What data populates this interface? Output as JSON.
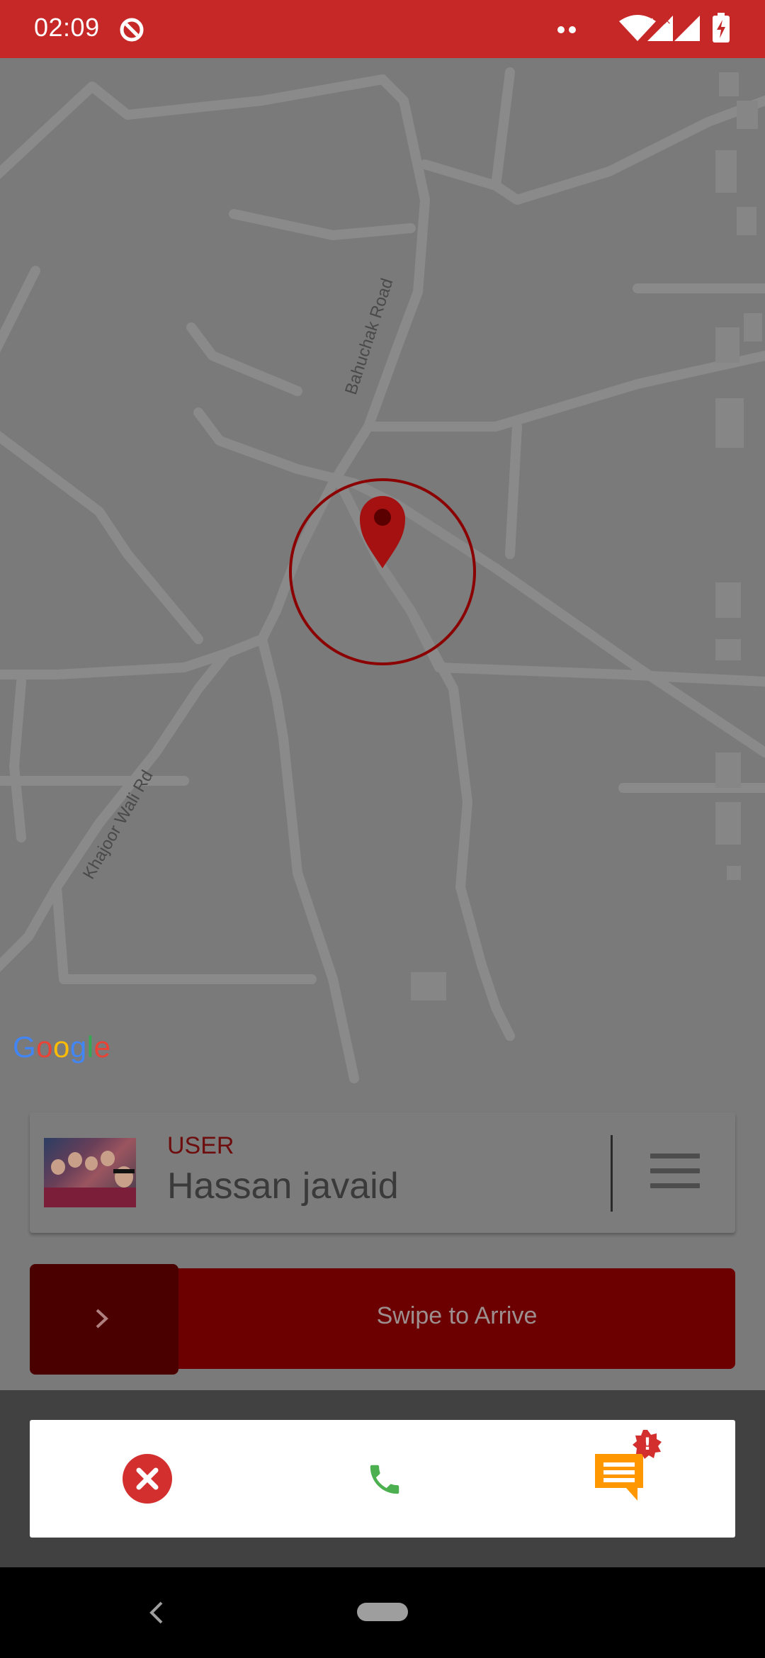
{
  "status_bar": {
    "time": "02:09",
    "icons": [
      "sync-icon",
      "more-dots-icon",
      "wifi-icon",
      "signal-icon",
      "signal-icon",
      "battery-charging-icon"
    ],
    "background": "#c62828"
  },
  "map": {
    "road_labels": [
      "Bahuchak Road",
      "Khajoor Wali Rd"
    ],
    "provider_logo": "Google",
    "marker_icon": "map-pin-icon",
    "marker_color": "#b71c1c"
  },
  "user_card": {
    "role": "USER",
    "name": "Hassan javaid",
    "menu_icon": "hamburger-menu-icon"
  },
  "swipe": {
    "label": "Swipe to Arrive",
    "handle_icon": "chevron-right-icon",
    "color": "#6c0000"
  },
  "actions": [
    {
      "name": "cancel",
      "icon": "cancel-circle-icon",
      "color": "#d32f2f"
    },
    {
      "name": "call",
      "icon": "phone-icon",
      "color": "#4caf50"
    },
    {
      "name": "chat",
      "icon": "chat-icon",
      "color": "#ff9800",
      "badge": "!"
    }
  ],
  "nav_bar": {
    "icons": [
      "back-icon",
      "home-pill"
    ]
  }
}
